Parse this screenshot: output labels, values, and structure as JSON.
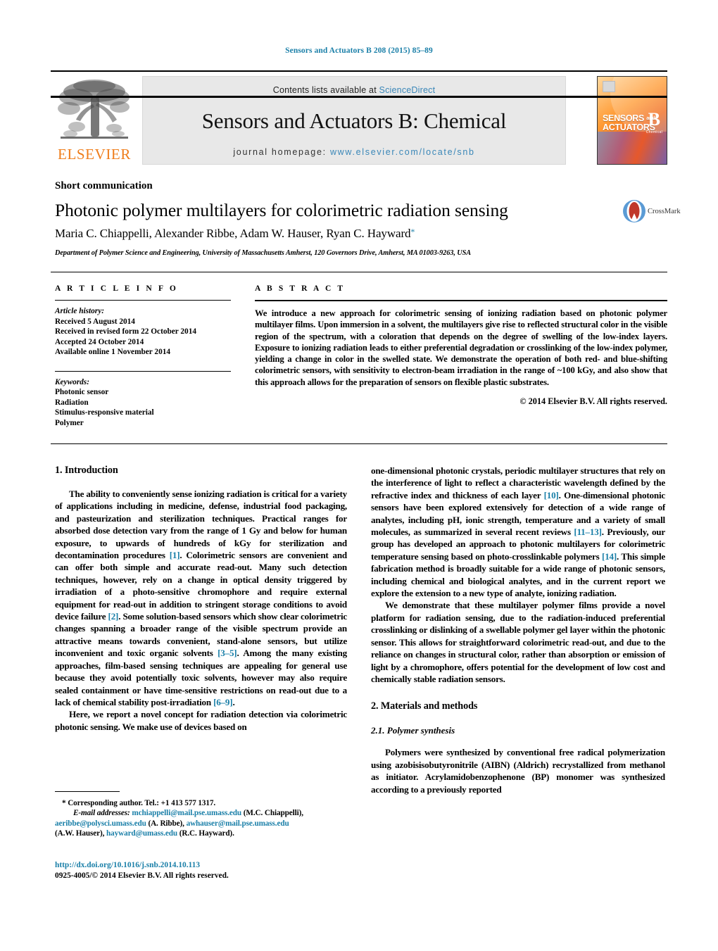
{
  "running_head": "Sensors and Actuators B 208 (2015) 85–89",
  "masthead": {
    "publisher_name": "ELSEVIER",
    "contents_prefix": "Contents lists available at ",
    "contents_link": "ScienceDirect",
    "journal_title": "Sensors and Actuators B: Chemical",
    "homepage_prefix": "journal homepage: ",
    "homepage_url": "www.elsevier.com/locate/snb",
    "cover": {
      "line1": "SENSORS",
      "and": "and",
      "line2": "ACTUATORS",
      "letter": "B",
      "sub": "Chemical"
    }
  },
  "title_block": {
    "doctype": "Short communication",
    "title": "Photonic polymer multilayers for colorimetric radiation sensing",
    "authors": "Maria C. Chiappelli, Alexander Ribbe, Adam W. Hauser, Ryan C. Hayward",
    "corresponding_marker": "*",
    "affiliation": "Department of Polymer Science and Engineering, University of Massachusetts Amherst, 120 Governors Drive, Amherst, MA 01003-9263, USA",
    "crossmark_label": "CrossMark"
  },
  "article_info": {
    "heading": "A R T I C L E   I N F O",
    "history_label": "Article history:",
    "history": [
      "Received 5 August 2014",
      "Received in revised form 22 October 2014",
      "Accepted 24 October 2014",
      "Available online 1 November 2014"
    ],
    "keywords_label": "Keywords:",
    "keywords": [
      "Photonic sensor",
      "Radiation",
      "Stimulus-responsive material",
      "Polymer"
    ]
  },
  "abstract": {
    "heading": "A B S T R A C T",
    "text": "We introduce a new approach for colorimetric sensing of ionizing radiation based on photonic polymer multilayer films. Upon immersion in a solvent, the multilayers give rise to reflected structural color in the visible region of the spectrum, with a coloration that depends on the degree of swelling of the low-index layers. Exposure to ionizing radiation leads to either preferential degradation or crosslinking of the low-index polymer, yielding a change in color in the swelled state. We demonstrate the operation of both red- and blue-shifting colorimetric sensors, with sensitivity to electron-beam irradiation in the range of ~100 kGy, and also show that this approach allows for the preparation of sensors on flexible plastic substrates.",
    "copyright": "© 2014 Elsevier B.V. All rights reserved."
  },
  "body": {
    "left": {
      "section1_heading": "1.  Introduction",
      "para1_a": "The ability to conveniently sense ionizing radiation is critical for a variety of applications including in medicine, defense, industrial food packaging, and pasteurization and sterilization techniques. Practical ranges for absorbed dose detection vary from the range of 1 Gy and below for human exposure, to upwards of hundreds of kGy for sterilization and decontamination procedures ",
      "ref1": "[1]",
      "para1_b": ". Colorimetric sensors are convenient and can offer both simple and accurate read-out. Many such detection techniques, however, rely on a change in optical density triggered by irradiation of a photo-sensitive chromophore and require external equipment for read-out in addition to stringent storage conditions to avoid device failure ",
      "ref2": "[2]",
      "para1_c": ". Some solution-based sensors which show clear colorimetric changes spanning a broader range of the visible spectrum provide an attractive means towards convenient, stand-alone sensors, but utilize inconvenient and toxic organic solvents ",
      "ref3": "[3–5]",
      "para1_d": ". Among the many existing approaches, film-based sensing techniques are appealing for general use because they avoid potentially toxic solvents, however may also require sealed containment or have time-sensitive restrictions on read-out due to a lack of chemical stability post-irradiation ",
      "ref4": "[6–9]",
      "para1_e": ".",
      "para2_a": "Here, we report a novel concept for radiation detection via colorimetric photonic sensing. We make use of devices based on"
    },
    "right": {
      "para3_a": "one-dimensional photonic crystals, periodic multilayer structures that rely on the interference of light to reflect a characteristic wavelength defined by the refractive index and thickness of each layer ",
      "ref10": "[10]",
      "para3_b": ". One-dimensional photonic sensors have been explored extensively for detection of a wide range of analytes, including pH, ionic strength, temperature and a variety of small molecules, as summarized in several recent reviews ",
      "ref11": "[11–13]",
      "para3_c": ". Previously, our group has developed an approach to photonic multilayers for colorimetric temperature sensing based on photo-crosslinkable polymers ",
      "ref14": "[14]",
      "para3_d": ". This simple fabrication method is broadly suitable for a wide range of photonic sensors, including chemical and biological analytes, and in the current report we explore the extension to a new type of analyte, ionizing radiation.",
      "para4": "We demonstrate that these multilayer polymer films provide a novel platform for radiation sensing, due to the radiation-induced preferential crosslinking or dislinking of a swellable polymer gel layer within the photonic sensor. This allows for straightforward colorimetric read-out, and due to the reliance on changes in structural color, rather than absorption or emission of light by a chromophore, offers potential for the development of low cost and chemically stable radiation sensors.",
      "section2_heading": "2.  Materials and methods",
      "subsection21_heading": "2.1.  Polymer synthesis",
      "para5": "Polymers were synthesized by conventional free radical polymerization using azobisisobutyronitrile (AIBN) (Aldrich) recrystallized from methanol as initiator. Acrylamidobenzophenone (BP) monomer was synthesized according to a previously reported"
    }
  },
  "footnote": {
    "corresponding": "* Corresponding author. Tel.: +1 413 577 1317.",
    "email_label": "E-mail addresses:",
    "email1": "mchiappelli@mail.pse.umass.edu",
    "email1_name": " (M.C. Chiappelli),",
    "email2": "aeribbe@polysci.umass.edu",
    "email2_name": " (A. Ribbe),",
    "email3": "awhauser@mail.pse.umass.edu",
    "email3_name": "(A.W. Hauser),",
    "email4": "hayward@umass.edu",
    "email4_name": " (R.C. Hayward)."
  },
  "doi_block": {
    "doi_url": "http://dx.doi.org/10.1016/j.snb.2014.10.113",
    "issn_line": "0925-4005/© 2014 Elsevier B.V. All rights reserved."
  },
  "colors": {
    "link_blue": "#1a7fa8",
    "masthead_link": "#3a87b8",
    "elsevier_orange": "#ef7d1a",
    "band_grey": "#e8e8e8"
  }
}
